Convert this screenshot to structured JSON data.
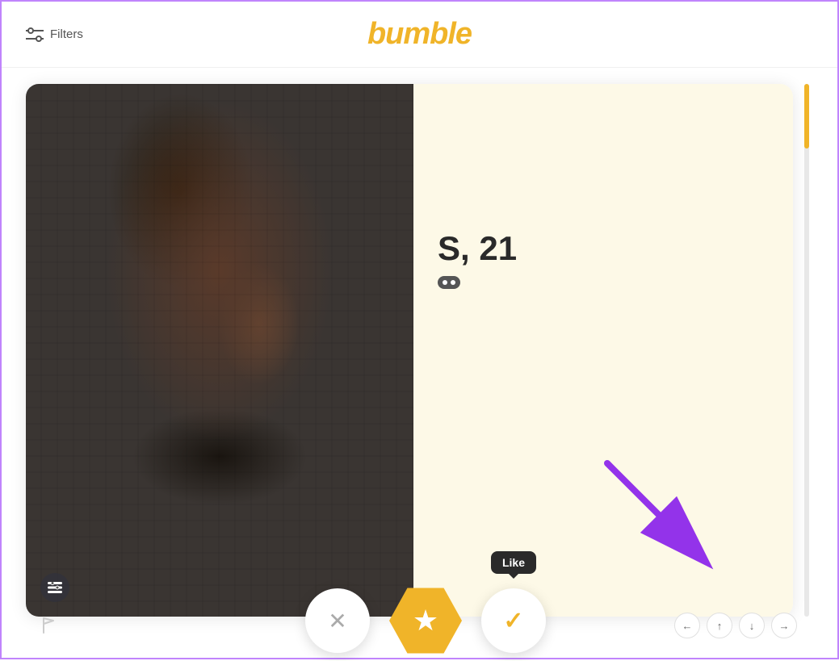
{
  "header": {
    "logo": "bumble",
    "filters_label": "Filters"
  },
  "card": {
    "profile_name": "S, 21",
    "like_tooltip": "Like",
    "scrollbar_visible": true
  },
  "action_buttons": {
    "dislike_label": "✕",
    "superlike_label": "★",
    "like_label": "✓"
  },
  "nav_buttons": {
    "left": "←",
    "up": "↑",
    "down": "↓",
    "right": "→"
  },
  "icons": {
    "filters": "filter-icon",
    "report": "flag-icon",
    "profile_badge": "dots-icon",
    "photo_badge": "badge-icon"
  },
  "colors": {
    "accent": "#f0b429",
    "background": "#fdf9e7",
    "arrow": "#9333ea",
    "dark": "#2a2a2a"
  }
}
